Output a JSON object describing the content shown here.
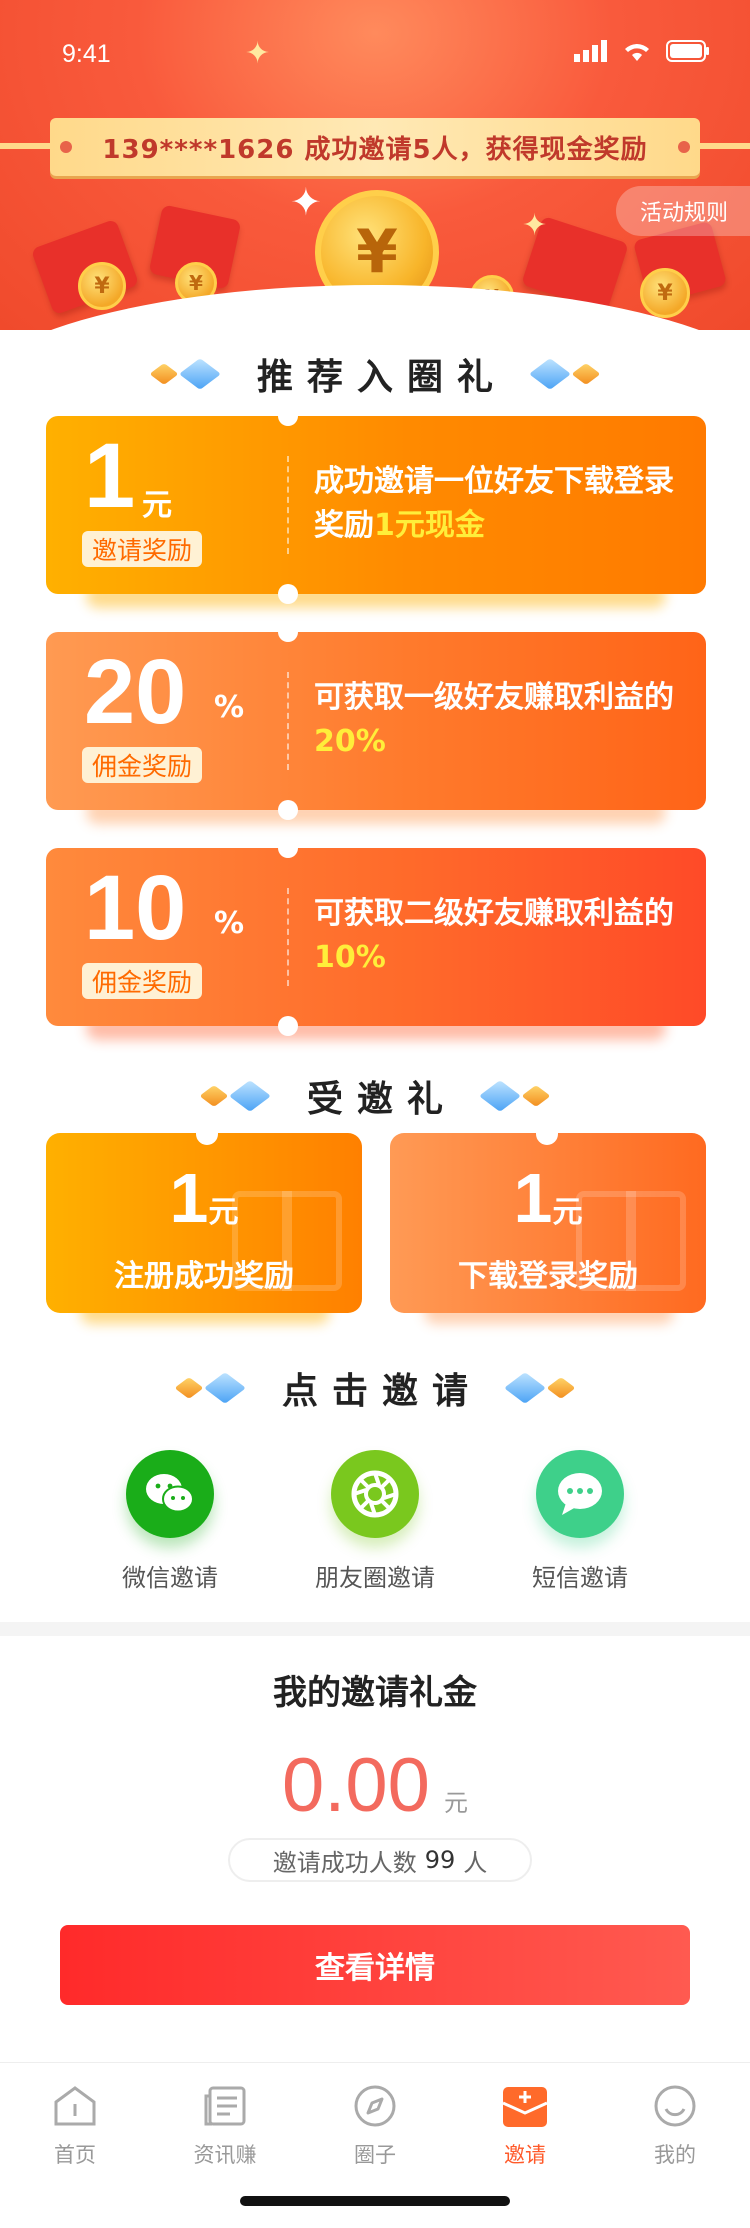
{
  "status_bar": {
    "time": "9:41"
  },
  "hero": {
    "banner_text": "139****1626 成功邀请5人，获得现金奖励",
    "rules_button": "活动规则",
    "coin_symbol": "¥"
  },
  "referral_section": {
    "title": "推荐入圈礼",
    "cards": [
      {
        "amount": "1",
        "unit": "元",
        "tag": "邀请奖励",
        "desc": "成功邀请一位好友下载登录奖励",
        "highlight": "1元现金"
      },
      {
        "amount": "20",
        "unit": "%",
        "tag": "佣金奖励",
        "desc": "可获取一级好友赚取利益的",
        "highlight": "20%"
      },
      {
        "amount": "10",
        "unit": "%",
        "tag": "佣金奖励",
        "desc": "可获取二级好友赚取利益的",
        "highlight": "10%"
      }
    ]
  },
  "invitee_section": {
    "title": "受邀礼",
    "cards": [
      {
        "amount": "1",
        "unit": "元",
        "label": "注册成功奖励"
      },
      {
        "amount": "1",
        "unit": "元",
        "label": "下载登录奖励"
      }
    ]
  },
  "share_section": {
    "title": "点击邀请",
    "items": [
      {
        "label": "微信邀请",
        "icon": "wechat-icon",
        "color": "#1aad19"
      },
      {
        "label": "朋友圈邀请",
        "icon": "moments-icon",
        "color": "#7ac81e"
      },
      {
        "label": "短信邀请",
        "icon": "sms-icon",
        "color": "#3ed08a"
      }
    ]
  },
  "my_reward": {
    "title": "我的邀请礼金",
    "amount": "0.00",
    "unit": "元",
    "count_prefix": "邀请成功人数",
    "count": "99",
    "count_suffix": "人",
    "detail_button": "查看详情"
  },
  "tab_bar": {
    "items": [
      {
        "label": "首页",
        "icon": "home-icon"
      },
      {
        "label": "资讯赚",
        "icon": "news-icon"
      },
      {
        "label": "圈子",
        "icon": "compass-icon"
      },
      {
        "label": "邀请",
        "icon": "invite-icon",
        "active": true
      },
      {
        "label": "我的",
        "icon": "profile-icon"
      }
    ]
  },
  "colors": {
    "accent": "#ff5a2a",
    "amount": "#f36a5e",
    "button": "#ff2a2a"
  }
}
